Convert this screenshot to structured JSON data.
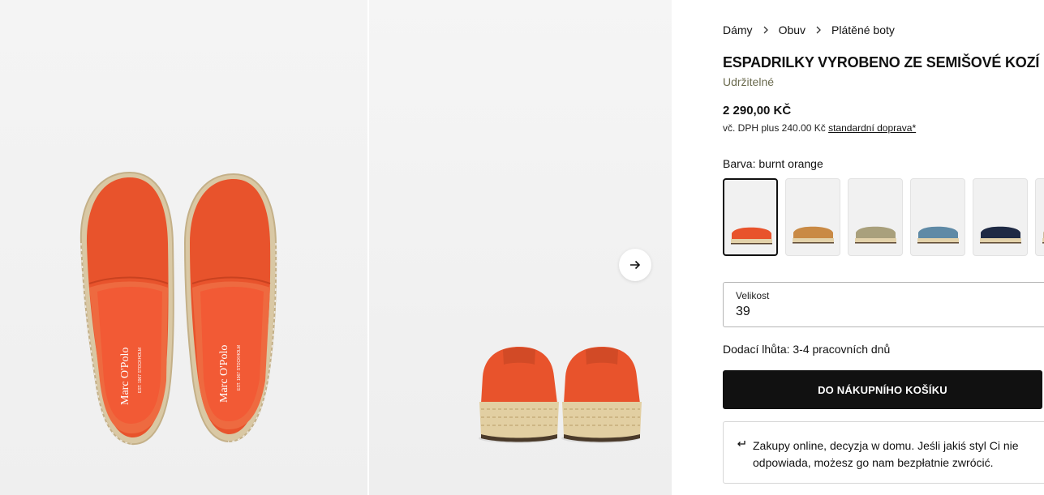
{
  "breadcrumb": [
    "Dámy",
    "Obuv",
    "Plátěné boty"
  ],
  "product": {
    "title": "ESPADRILKY VYROBENO ZE SEMIŠOVÉ KOZÍ KŮŽE",
    "tag": "Udržitelné",
    "price": "2 290,00 KČ",
    "vat_prefix": "vč. DPH plus 240.00 Kč",
    "shipping_link": "standardní doprava*",
    "insole_brand": "Marc O'Polo",
    "insole_sub": "EST. 1967 STOCKHOLM"
  },
  "color": {
    "label": "Barva: burnt orange",
    "swatches": [
      {
        "name": "burnt orange",
        "hex": "#e8532c",
        "selected": true
      },
      {
        "name": "tan",
        "hex": "#c98a45",
        "selected": false
      },
      {
        "name": "olive",
        "hex": "#a9a07c",
        "selected": false
      },
      {
        "name": "blue",
        "hex": "#5f8aa6",
        "selected": false
      },
      {
        "name": "navy",
        "hex": "#1f2a44",
        "selected": false
      },
      {
        "name": "beige",
        "hex": "#cdb79a",
        "selected": false
      }
    ]
  },
  "size": {
    "label": "Velikost",
    "value": "39"
  },
  "delivery": "Dodací lhůta: 3-4 pracovních dnů",
  "cart_button": "DO NÁKUPNÍHO KOŠÍKU",
  "returns": {
    "icon": "return-arrow-icon",
    "text": "Zakupy online, decyzja w domu. Jeśli jakiś styl Ci nie odpowiada, możesz go nam bezpłatnie zwrócić."
  },
  "icons": {
    "next": "arrow-right-icon",
    "breadcrumb_separator": "chevron-right-icon"
  },
  "colors": {
    "product": "#e8532c",
    "dark": "#111111",
    "tag": "#6b6b4f"
  }
}
